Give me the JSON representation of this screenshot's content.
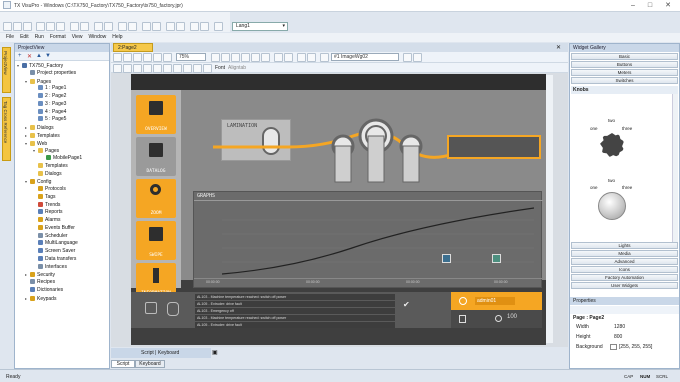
{
  "app": {
    "title": "TX VisuPro - Windows (C:\\TX750_Factory\\TX750_Factory\\tx750_factory.jpr)",
    "language_select": "Lang1"
  },
  "menu": [
    "File",
    "Edit",
    "Run",
    "Format",
    "View",
    "Window",
    "Help"
  ],
  "left_panel": {
    "title": "ProjectView",
    "side_tabs": [
      "ProjectView",
      "Tag Cross Reference"
    ],
    "tree": [
      {
        "label": "TX750_Factory",
        "level": 0,
        "icon": "project-icon",
        "color": "#4a6fa5",
        "exp": "▾"
      },
      {
        "label": "Project properties",
        "level": 1,
        "icon": "properties-icon",
        "color": "#7a8fa8",
        "exp": ""
      },
      {
        "label": "Pages",
        "level": 1,
        "icon": "folder-icon",
        "color": "#e8c14a",
        "exp": "▾"
      },
      {
        "label": "1 : Page1",
        "level": 2,
        "icon": "page-icon",
        "color": "#6a8ec0",
        "exp": ""
      },
      {
        "label": "2 : Page2",
        "level": 2,
        "icon": "page-icon",
        "color": "#6a8ec0",
        "exp": ""
      },
      {
        "label": "3 : Page3",
        "level": 2,
        "icon": "page-icon",
        "color": "#6a8ec0",
        "exp": ""
      },
      {
        "label": "4 : Page4",
        "level": 2,
        "icon": "page-icon",
        "color": "#6a8ec0",
        "exp": ""
      },
      {
        "label": "5 : Page5",
        "level": 2,
        "icon": "page-icon",
        "color": "#6a8ec0",
        "exp": ""
      },
      {
        "label": "Dialogs",
        "level": 1,
        "icon": "folder-icon",
        "color": "#e8c14a",
        "exp": "▸"
      },
      {
        "label": "Templates",
        "level": 1,
        "icon": "folder-icon",
        "color": "#e8c14a",
        "exp": "▸"
      },
      {
        "label": "Web",
        "level": 1,
        "icon": "folder-icon",
        "color": "#e8c14a",
        "exp": "▾"
      },
      {
        "label": "Pages",
        "level": 2,
        "icon": "folder-icon",
        "color": "#e8c14a",
        "exp": "▾"
      },
      {
        "label": "MobilePage1",
        "level": 3,
        "icon": "mobile-page-icon",
        "color": "#3a9a4a",
        "exp": ""
      },
      {
        "label": "Templates",
        "level": 2,
        "icon": "folder-icon",
        "color": "#e8c14a",
        "exp": ""
      },
      {
        "label": "Dialogs",
        "level": 2,
        "icon": "folder-icon",
        "color": "#e8c14a",
        "exp": ""
      },
      {
        "label": "Config",
        "level": 1,
        "icon": "config-icon",
        "color": "#d9a21b",
        "exp": "▾"
      },
      {
        "label": "Protocols",
        "level": 2,
        "icon": "protocol-icon",
        "color": "#d9a21b",
        "exp": ""
      },
      {
        "label": "Tags",
        "level": 2,
        "icon": "tag-icon",
        "color": "#d9a21b",
        "exp": ""
      },
      {
        "label": "Trends",
        "level": 2,
        "icon": "trend-icon",
        "color": "#d04a3a",
        "exp": ""
      },
      {
        "label": "Reports",
        "level": 2,
        "icon": "report-icon",
        "color": "#5a7fb8",
        "exp": ""
      },
      {
        "label": "Alarms",
        "level": 2,
        "icon": "alarm-icon",
        "color": "#d9a21b",
        "exp": ""
      },
      {
        "label": "Events Buffer",
        "level": 2,
        "icon": "events-icon",
        "color": "#d9a21b",
        "exp": ""
      },
      {
        "label": "Scheduler",
        "level": 2,
        "icon": "scheduler-icon",
        "color": "#7a8fa8",
        "exp": ""
      },
      {
        "label": "MultiLanguage",
        "level": 2,
        "icon": "language-icon",
        "color": "#5a7fb8",
        "exp": ""
      },
      {
        "label": "Screen Saver",
        "level": 2,
        "icon": "screensaver-icon",
        "color": "#5a7fb8",
        "exp": ""
      },
      {
        "label": "Data transfers",
        "level": 2,
        "icon": "transfer-icon",
        "color": "#5a7fb8",
        "exp": ""
      },
      {
        "label": "Interfaces",
        "level": 2,
        "icon": "interface-icon",
        "color": "#7a8fa8",
        "exp": ""
      },
      {
        "label": "Security",
        "level": 1,
        "icon": "security-icon",
        "color": "#d9a21b",
        "exp": "▸"
      },
      {
        "label": "Recipes",
        "level": 1,
        "icon": "recipe-icon",
        "color": "#7a8fa8",
        "exp": ""
      },
      {
        "label": "Dictionaries",
        "level": 1,
        "icon": "dictionary-icon",
        "color": "#5a7fb8",
        "exp": ""
      },
      {
        "label": "Keypads",
        "level": 1,
        "icon": "keypad-icon",
        "color": "#d9a21b",
        "exp": "▸"
      }
    ]
  },
  "editor": {
    "doc_tab": "2:Page2",
    "zoom": "75%",
    "image_select": "#1 ImageWg02",
    "font_label": "Font",
    "align_label": "Aligntab",
    "bottom_tabs": [
      "Script",
      "Keyboard"
    ],
    "bottom_panel_title": "Script | Keyboard"
  },
  "hmi": {
    "nav": [
      "OVERVIEW",
      "DATALOG",
      "ZOOM",
      "SWIPE",
      "INFORMATION"
    ],
    "lamination": "LAMINATION",
    "graphs_title": "GRAPHS",
    "x_ticks": [
      "00:00:00",
      "00:00:00",
      "00:00:00",
      "00:00:00"
    ],
    "alarms": [
      "AL103 - Machine temperature reached: switch off power",
      "AL105 - Extruder: drive fault",
      "AL103 - Emergency off",
      "AL103 - Machine temperature reached: switch off power",
      "AL105 - Extruder: drive fault"
    ],
    "user": "admin01",
    "counter": "100",
    "colors": {
      "accent": "#f5a623",
      "dark": "#3f3f3f",
      "mid": "#8a8a8a",
      "bg": "#d8dde3"
    }
  },
  "right_panel": {
    "title": "Widget Gallery",
    "top_buttons": [
      "Basic",
      "Buttons",
      "Meters",
      "Switches"
    ],
    "knobs_title": "Knobs",
    "knob1": {
      "left": "one",
      "top": "two",
      "right": "three"
    },
    "knob2": {
      "left": "one",
      "top": "two",
      "right": "three"
    },
    "bottom_buttons": [
      "Lights",
      "Media",
      "Advanced",
      "Icons",
      "Factory Automation",
      "User Widgets"
    ],
    "properties": {
      "title": "Properties",
      "page": "Page : Page2",
      "rows": [
        {
          "name": "Width",
          "value": "1280"
        },
        {
          "name": "Height",
          "value": "800"
        },
        {
          "name": "Background",
          "value": "[255, 255, 255]"
        }
      ]
    }
  },
  "status": {
    "ready": "Ready",
    "indicators": [
      "CAP",
      "NUM",
      "SCRL"
    ]
  }
}
